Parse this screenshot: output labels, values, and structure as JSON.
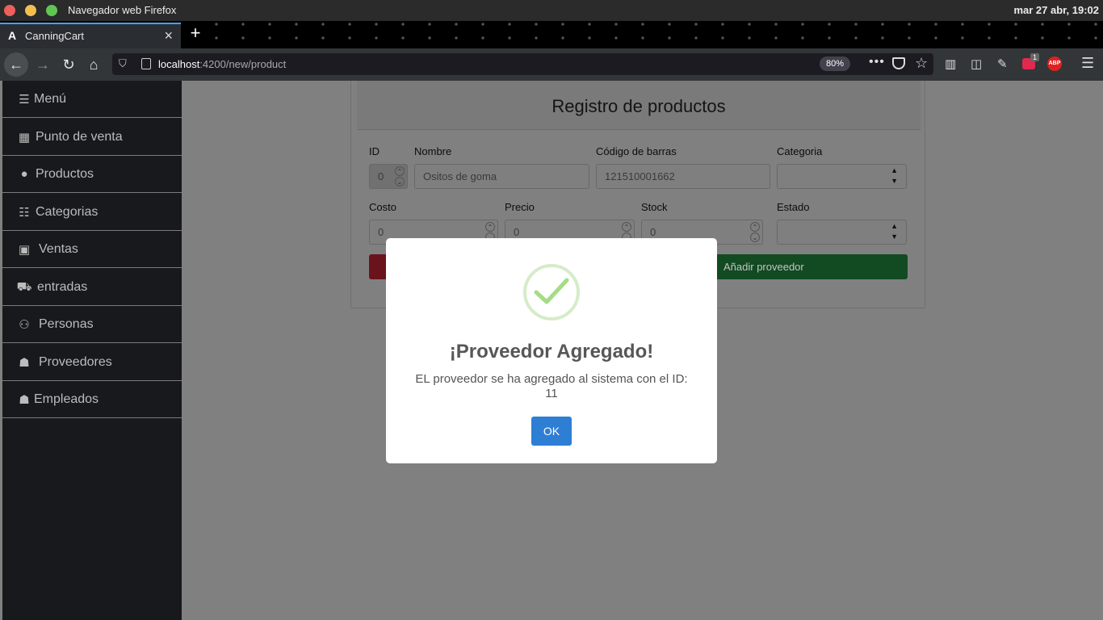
{
  "os": {
    "window_title": "Navegador web Firefox",
    "clock": "mar 27 abr, 19:02"
  },
  "browser": {
    "tab_title": "CanningCart",
    "url_host": "localhost",
    "url_path": ":4200/new/product",
    "zoom": "80%",
    "extension_badge_count": "1",
    "abp_label": "ABP"
  },
  "sidebar": {
    "items": [
      {
        "label": "Menú",
        "icon": "bars-icon"
      },
      {
        "label": "Punto de venta",
        "icon": "cash-register-icon"
      },
      {
        "label": "Productos",
        "icon": "cookie-icon"
      },
      {
        "label": "Categorias",
        "icon": "list-icon"
      },
      {
        "label": "Ventas",
        "icon": "money-bill-icon"
      },
      {
        "label": "entradas",
        "icon": "cart-icon"
      },
      {
        "label": "Personas",
        "icon": "users-icon"
      },
      {
        "label": "Proveedores",
        "icon": "user-truck-icon"
      },
      {
        "label": "Empleados",
        "icon": "user-tie-icon"
      }
    ]
  },
  "form": {
    "title": "Registro de productos",
    "id_label": "ID",
    "id_value": "0",
    "nombre_label": "Nombre",
    "nombre_value": "Ositos de goma",
    "codigo_label": "Código de barras",
    "codigo_value": "121510001662",
    "categoria_label": "Categoria",
    "categoria_value": "",
    "costo_label": "Costo",
    "costo_value": "0",
    "precio_label": "Precio",
    "precio_value": "0",
    "stock_label": "Stock",
    "stock_value": "0",
    "estado_label": "Estado",
    "estado_value": "",
    "add_supplier_label": "Añadir proveedor"
  },
  "modal": {
    "title": "¡Proveedor Agregado!",
    "text": "EL proveedor se ha agregado al sistema con el ID:",
    "id_value": "11",
    "ok_label": "OK",
    "accent_color": "#2e7ed4",
    "success_color": "#a5dc86"
  }
}
